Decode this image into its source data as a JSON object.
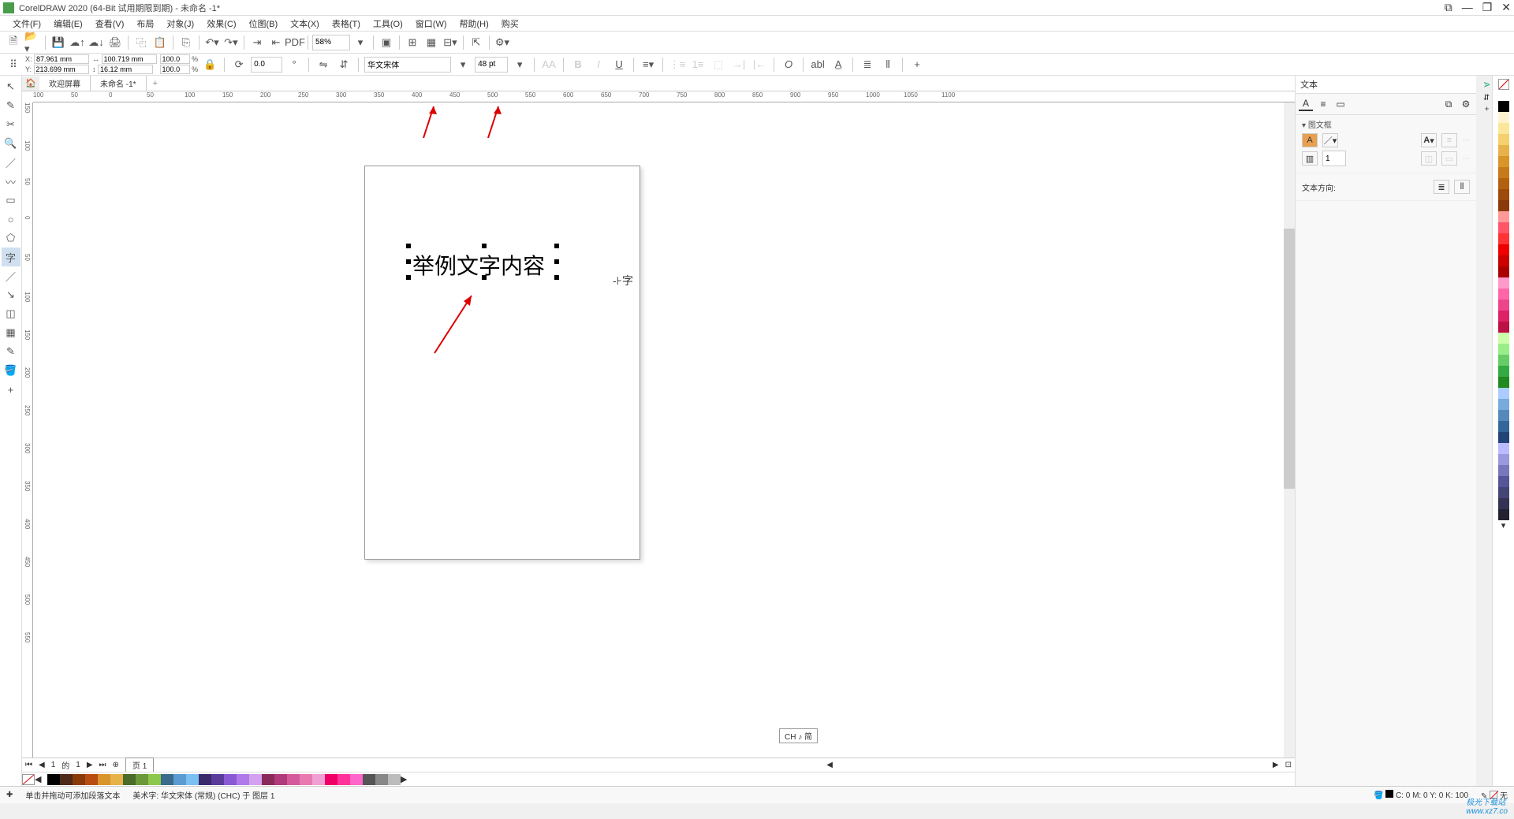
{
  "title_bar": {
    "text": "CorelDRAW 2020 (64-Bit 试用期限到期) - 未命名 -1*"
  },
  "menu": {
    "file": "文件(F)",
    "edit": "编辑(E)",
    "view": "查看(V)",
    "layout": "布局",
    "object": "对象(J)",
    "effects": "效果(C)",
    "bitmap": "位图(B)",
    "text": "文本(X)",
    "table": "表格(T)",
    "tools": "工具(O)",
    "window": "窗口(W)",
    "help": "帮助(H)",
    "buy": "购买"
  },
  "toolbar": {
    "zoom": "58%"
  },
  "props": {
    "x_label": "X:",
    "x_value": "87.961 mm",
    "y_label": "Y:",
    "y_value": "213.699 mm",
    "w_value": "100.719 mm",
    "h_value": "16.12 mm",
    "sx": "100.0",
    "sy": "100.0",
    "pct": "%",
    "rotation": "0.0",
    "font": "华文宋体",
    "size": "48 pt"
  },
  "tabs": {
    "welcome": "欢迎屏幕",
    "doc": "未命名 -1*",
    "add": "+"
  },
  "ruler_marks_h": [
    "100",
    "50",
    "0",
    "50",
    "100",
    "150",
    "200",
    "250",
    "300",
    "350",
    "400",
    "450",
    "500",
    "550",
    "600",
    "650",
    "700",
    "750",
    "800",
    "850",
    "900",
    "950",
    "1000",
    "1050",
    "1100"
  ],
  "ruler_marks_v": [
    "150",
    "100",
    "50",
    "0",
    "50",
    "100",
    "150",
    "200",
    "250",
    "300",
    "350",
    "400",
    "450",
    "500",
    "550"
  ],
  "canvas": {
    "sample_text": "举例文字内容"
  },
  "panel": {
    "title": "文本",
    "frame_title": "图文框",
    "columns": "1",
    "direction_label": "文本方向:"
  },
  "lang_indicator": "CH ♪ 简",
  "page_nav": {
    "page1": "页 1",
    "cur": "1",
    "of_prefix": "的"
  },
  "status": {
    "hint": "单击并拖动可添加段落文本",
    "artistic_label": "美术字:",
    "artistic_value": "华文宋体 (常规) (CHC) 于 图层 1",
    "cmyk": "C: 0 M: 0 Y: 0 K: 100",
    "none": "无"
  },
  "palette_colors": [
    "#ffffff",
    "#000000",
    "#fff3cf",
    "#fce699",
    "#f4d06f",
    "#e8b24a",
    "#d9952a",
    "#c87a1a",
    "#b4600f",
    "#9e4a0a",
    "#8a3a08",
    "#f99",
    "#f56",
    "#f33",
    "#e00",
    "#c00",
    "#a00",
    "#f9c",
    "#f6a",
    "#e48",
    "#d26",
    "#b14",
    "#cfa",
    "#9e8",
    "#6c6",
    "#3a4",
    "#282",
    "#acf",
    "#7ad",
    "#58b",
    "#369",
    "#247",
    "#bbf",
    "#99d",
    "#77b",
    "#559",
    "#447",
    "#335",
    "#223"
  ],
  "colorbar": [
    "#000000",
    "#4d2a1a",
    "#8a3a08",
    "#b94c10",
    "#d9952a",
    "#e8b24a",
    "#4a6b2a",
    "#6c9a3a",
    "#8cc84b",
    "#3a6b8c",
    "#5a9bd4",
    "#7ac0f0",
    "#3a2a6b",
    "#5a3a9b",
    "#8a5ad4",
    "#b07ae8",
    "#d4a0f0",
    "#8a2a5a",
    "#b03a7a",
    "#d45a9b",
    "#e87ab0",
    "#f0a0d4",
    "#e06",
    "#f39",
    "#f6c",
    "#555",
    "#888",
    "#bbb"
  ],
  "watermark": {
    "brand": "极光下载站",
    "url": "www.xz7.co"
  }
}
